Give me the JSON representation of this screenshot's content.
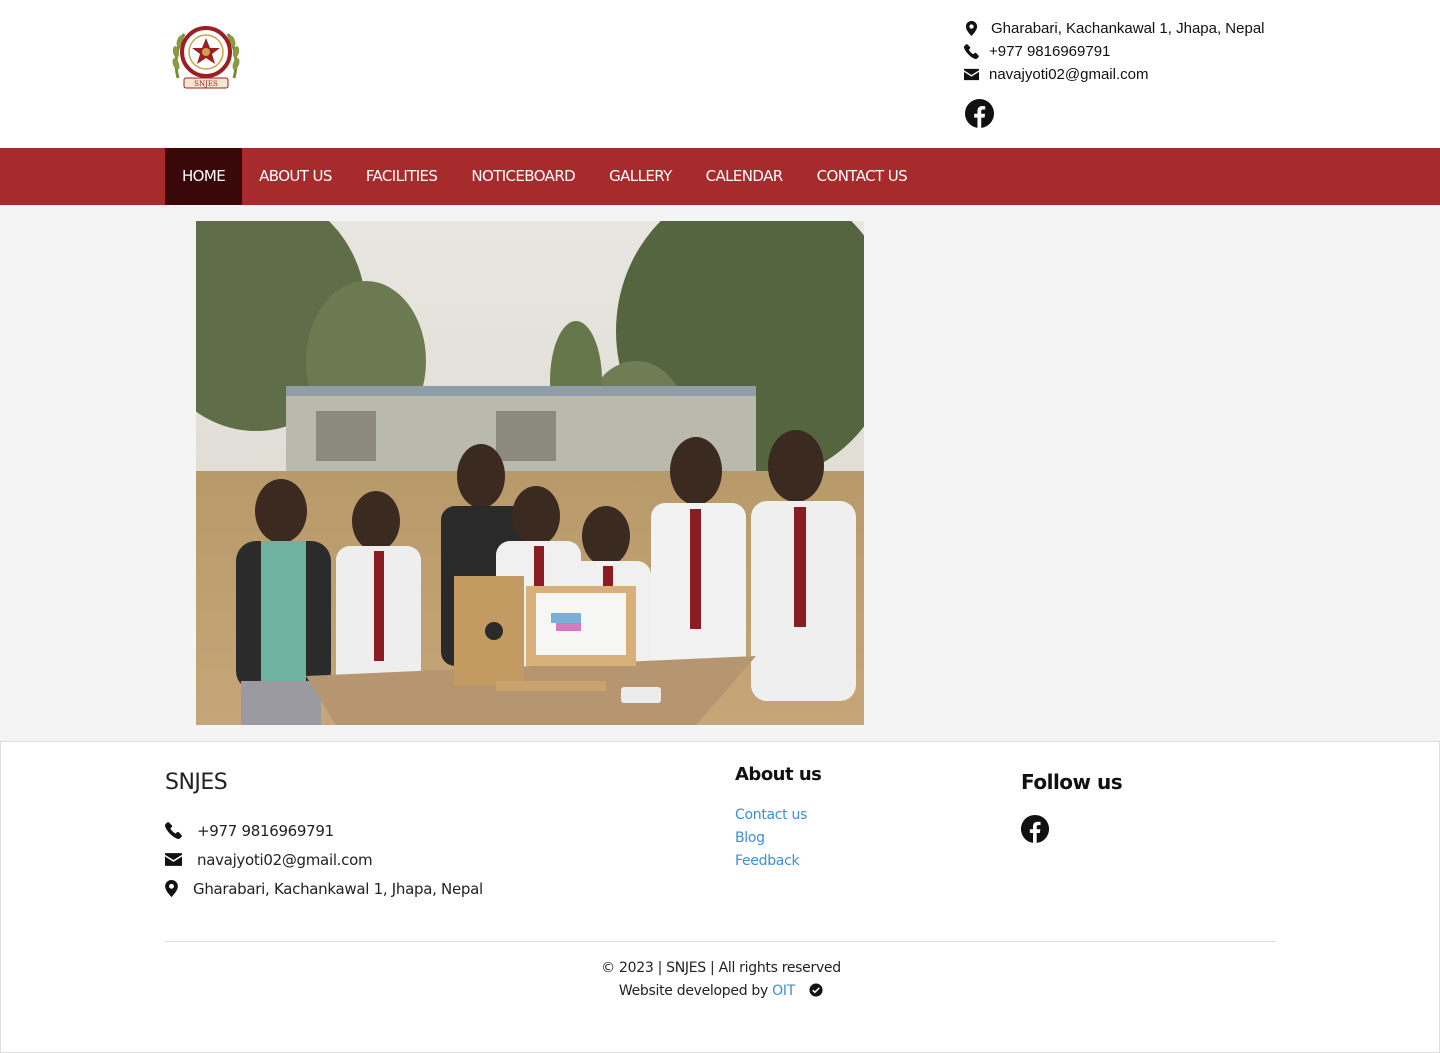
{
  "header": {
    "logo_icon": "school-crest-logo",
    "logo_text": "SNJES",
    "address": "Gharabari, Kachankawal 1, Jhapa, Nepal",
    "phone": "+977 9816969791",
    "email": "navajyoti02@gmail.com",
    "social_icon": "facebook-icon"
  },
  "nav": {
    "items": [
      {
        "label": "HOME",
        "active": true
      },
      {
        "label": "ABOUT US"
      },
      {
        "label": "FACILITIES"
      },
      {
        "label": "NOTICEBOARD"
      },
      {
        "label": "GALLERY"
      },
      {
        "label": "CALENDAR"
      },
      {
        "label": "CONTACT US"
      }
    ],
    "bg_color": "#a72b2d",
    "active_color": "#3a0808"
  },
  "main": {
    "photo_description_icon": "students-project-photo"
  },
  "footer": {
    "brand": "SNJES",
    "phone": "+977 9816969791",
    "email": "navajyoti02@gmail.com",
    "address": "Gharabari, Kachankawal 1, Jhapa, Nepal",
    "about_heading": "About us",
    "links": [
      "Contact us",
      "Blog",
      "Feedback"
    ],
    "follow_heading": "Follow us",
    "copyright": "© 2023 | SNJES | All rights reserved",
    "developed_by": "Website developed by",
    "developer": "OIT",
    "link_color": "#3a8fd8"
  }
}
